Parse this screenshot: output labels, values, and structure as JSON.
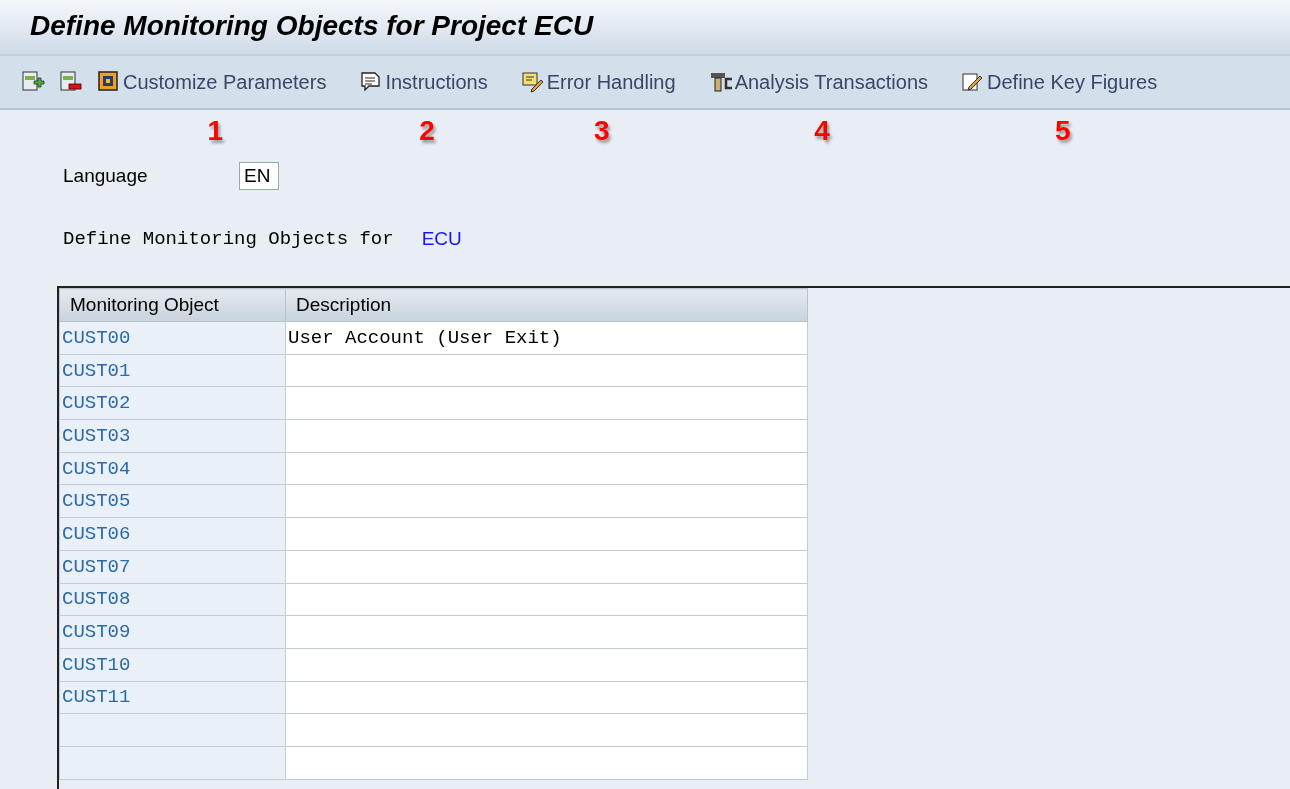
{
  "window": {
    "title": "Define Monitoring Objects for Project ECU"
  },
  "toolbar": {
    "icon_buttons": [
      {
        "kind": "add"
      },
      {
        "kind": "remove"
      }
    ],
    "buttons": [
      {
        "kind": "customize",
        "label": "Customize Parameters",
        "callout": "1"
      },
      {
        "kind": "instructions",
        "label": "Instructions",
        "callout": "2"
      },
      {
        "kind": "error",
        "label": "Error Handling",
        "callout": "3"
      },
      {
        "kind": "analysis",
        "label": "Analysis Transactions",
        "callout": "4"
      },
      {
        "kind": "keyfigures",
        "label": "Define Key Figures",
        "callout": "5"
      }
    ]
  },
  "language": {
    "label": "Language",
    "value": "EN"
  },
  "heading": {
    "text": "Define Monitoring Objects for",
    "project": "ECU"
  },
  "table": {
    "columns": [
      "Monitoring Object",
      "Description"
    ],
    "rows": [
      {
        "object": "CUST00",
        "description": "User Account (User Exit)"
      },
      {
        "object": "CUST01"
      },
      {
        "object": "CUST02"
      },
      {
        "object": "CUST03"
      },
      {
        "object": "CUST04"
      },
      {
        "object": "CUST05"
      },
      {
        "object": "CUST06"
      },
      {
        "object": "CUST07"
      },
      {
        "object": "CUST08"
      },
      {
        "object": "CUST09"
      },
      {
        "object": "CUST10"
      },
      {
        "object": "CUST11"
      }
    ]
  }
}
